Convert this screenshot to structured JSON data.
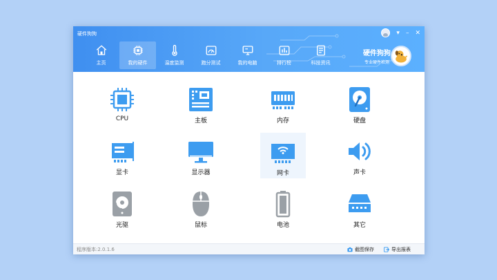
{
  "window": {
    "title": "硬件狗狗",
    "controls": {
      "menu": "▾",
      "minimize": "–",
      "close": "✕"
    }
  },
  "nav": {
    "items": [
      {
        "label": "主页",
        "icon": "home-icon"
      },
      {
        "label": "我的硬件",
        "icon": "chip-icon",
        "active": true
      },
      {
        "label": "温度监测",
        "icon": "thermometer-icon"
      },
      {
        "label": "跑分测试",
        "icon": "speedometer-icon"
      },
      {
        "label": "我的电脑",
        "icon": "computer-icon"
      },
      {
        "label": "排行榜",
        "icon": "ranking-icon"
      },
      {
        "label": "科技资讯",
        "icon": "news-icon"
      }
    ]
  },
  "brand": {
    "name": "硬件狗狗",
    "slogan": "专业硬件检测"
  },
  "hardware": {
    "items": [
      {
        "label": "CPU",
        "icon": "cpu-icon"
      },
      {
        "label": "主板",
        "icon": "motherboard-icon"
      },
      {
        "label": "内存",
        "icon": "memory-icon"
      },
      {
        "label": "硬盘",
        "icon": "hard-disk-icon"
      },
      {
        "label": "显卡",
        "icon": "graphics-card-icon"
      },
      {
        "label": "显示器",
        "icon": "monitor-icon"
      },
      {
        "label": "网卡",
        "icon": "network-card-icon",
        "selected": true
      },
      {
        "label": "声卡",
        "icon": "sound-card-icon"
      },
      {
        "label": "光驱",
        "icon": "optical-drive-icon"
      },
      {
        "label": "鼠标",
        "icon": "mouse-icon"
      },
      {
        "label": "电池",
        "icon": "battery-icon"
      },
      {
        "label": "其它",
        "icon": "other-device-icon"
      }
    ]
  },
  "footer": {
    "version": "程序版本:2.0.1.6",
    "screenshot_label": "截图保存",
    "export_label": "导出报表"
  },
  "colors": {
    "accent": "#4a9cf4",
    "icon_blue": "#3d9cf0",
    "icon_gray": "#9aa0a6"
  }
}
